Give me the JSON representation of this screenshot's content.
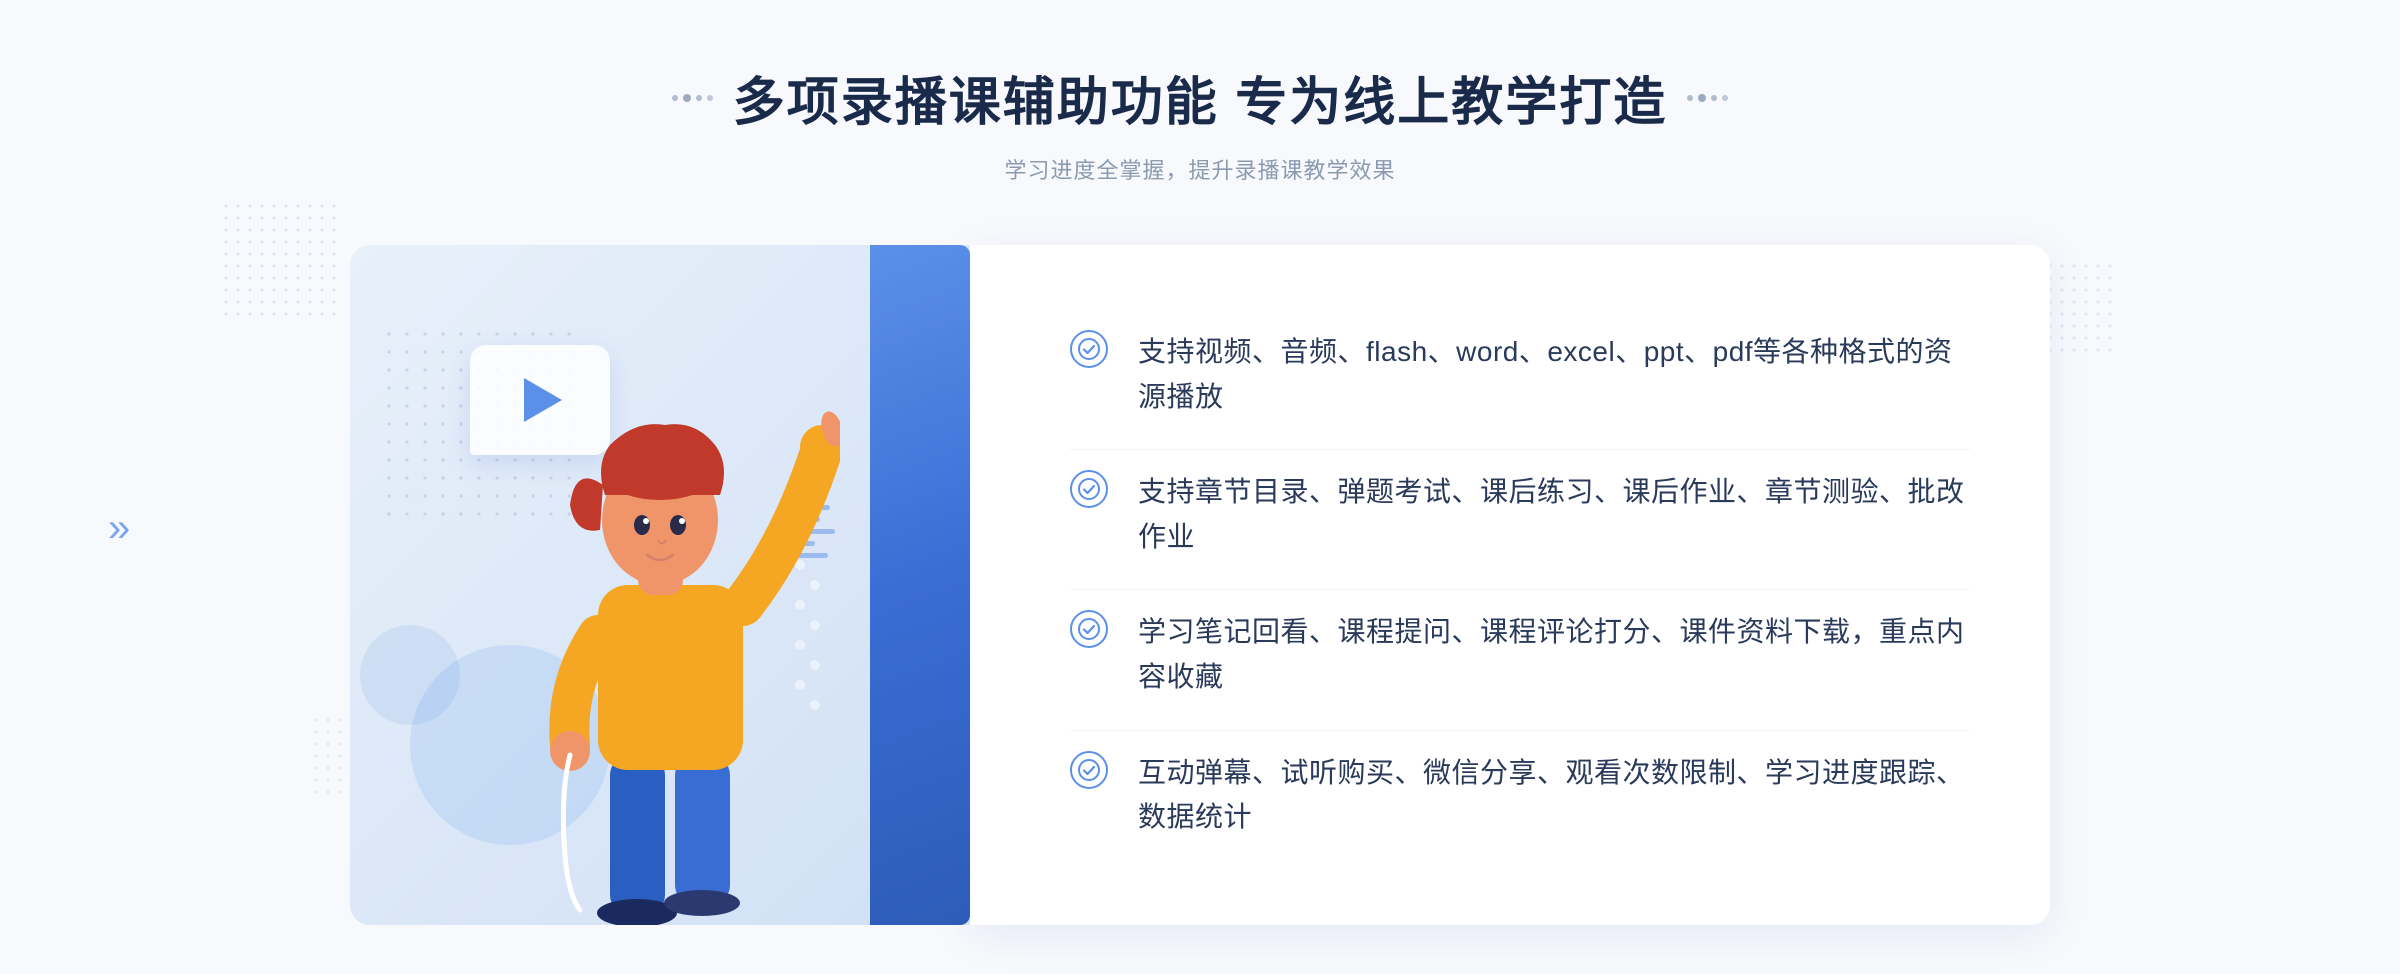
{
  "header": {
    "main_title": "多项录播课辅助功能 专为线上教学打造",
    "sub_title": "学习进度全掌握，提升录播课教学效果"
  },
  "features": [
    {
      "id": 1,
      "text": "支持视频、音频、flash、word、excel、ppt、pdf等各种格式的资源播放"
    },
    {
      "id": 2,
      "text": "支持章节目录、弹题考试、课后练习、课后作业、章节测验、批改作业"
    },
    {
      "id": 3,
      "text": "学习笔记回看、课程提问、课程评论打分、课件资料下载，重点内容收藏"
    },
    {
      "id": 4,
      "text": "互动弹幕、试听购买、微信分享、观看次数限制、学习进度跟踪、数据统计"
    }
  ],
  "decorations": {
    "chevron": "»",
    "play_button_title": "play-button"
  }
}
